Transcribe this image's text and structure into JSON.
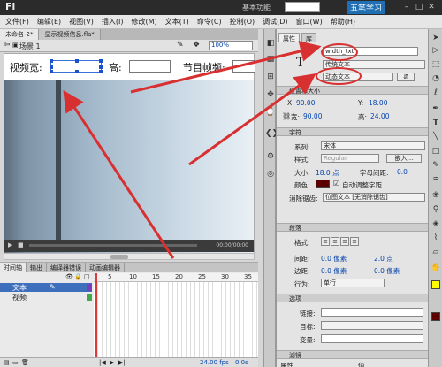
{
  "app": {
    "logo": "Fl",
    "workspace": "基本功能",
    "watermark": "五笔学习"
  },
  "menu": [
    "文件(F)",
    "编辑(E)",
    "视图(V)",
    "插入(I)",
    "修改(M)",
    "文本(T)",
    "命令(C)",
    "控制(O)",
    "调试(D)",
    "窗口(W)",
    "帮助(H)"
  ],
  "doc_tabs": [
    "未命名-2*",
    "显示视频信息.fla*"
  ],
  "scene": {
    "label": "场景 1",
    "zoom": "100%"
  },
  "stage": {
    "label_width": "视频宽:",
    "label_height": "高:",
    "label_fps": "节目帧频:",
    "time": "00:00/00:00"
  },
  "timeline": {
    "tabs": [
      "时间轴",
      "输出",
      "编译器错误",
      "动画编辑器"
    ],
    "ruler": [
      "1",
      "5",
      "10",
      "15",
      "20",
      "25",
      "30",
      "35"
    ],
    "layers": [
      {
        "name": "文本",
        "selected": true
      },
      {
        "name": "视频",
        "selected": false
      }
    ],
    "fps": "24.00 fps",
    "elapsed": "0.0s"
  },
  "properties": {
    "tabs": [
      "属性",
      "库"
    ],
    "instance_name": "width_txt",
    "text_engine": "传统文本",
    "text_type": "动态文本",
    "sections": {
      "position": "位置和大小",
      "char": "字符",
      "para": "段落",
      "options": "选项",
      "filters": "滤镜"
    },
    "x_label": "X:",
    "x_value": "90.00",
    "y_label": "Y:",
    "y_value": "18.00",
    "w_label": "宽:",
    "w_value": "90.00",
    "h_label": "高:",
    "h_value": "24.00",
    "family_label": "系列:",
    "family_value": "宋体",
    "style_label": "样式:",
    "style_value": "Regular",
    "embed_button": "嵌入...",
    "size_label": "大小:",
    "size_value": "18.0 点",
    "spacing_label": "字母间距:",
    "spacing_value": "0.0",
    "color_label": "颜色:",
    "text_color": "#5a0000",
    "autokern_label": "自动调整字距",
    "aa_label": "消除锯齿:",
    "aa_value": "位图文本 [无消除锯齿]",
    "format_label": "格式:",
    "gap_label": "间距:",
    "gap_value1": "0.0 像素",
    "gap_value2": "2.0 点",
    "margin_label": "边距:",
    "margin_value1": "0.0 像素",
    "margin_value2": "0.0 像素",
    "behavior_label": "行为:",
    "behavior_value": "单行",
    "link_label": "链接:",
    "target_label": "目标:",
    "var_label": "变量:",
    "filter_col": "属性",
    "value_col": "值"
  },
  "colors": {
    "annotation": "#d83030",
    "stage_bg": "#ffffff",
    "selection": "#3d6fbd"
  }
}
